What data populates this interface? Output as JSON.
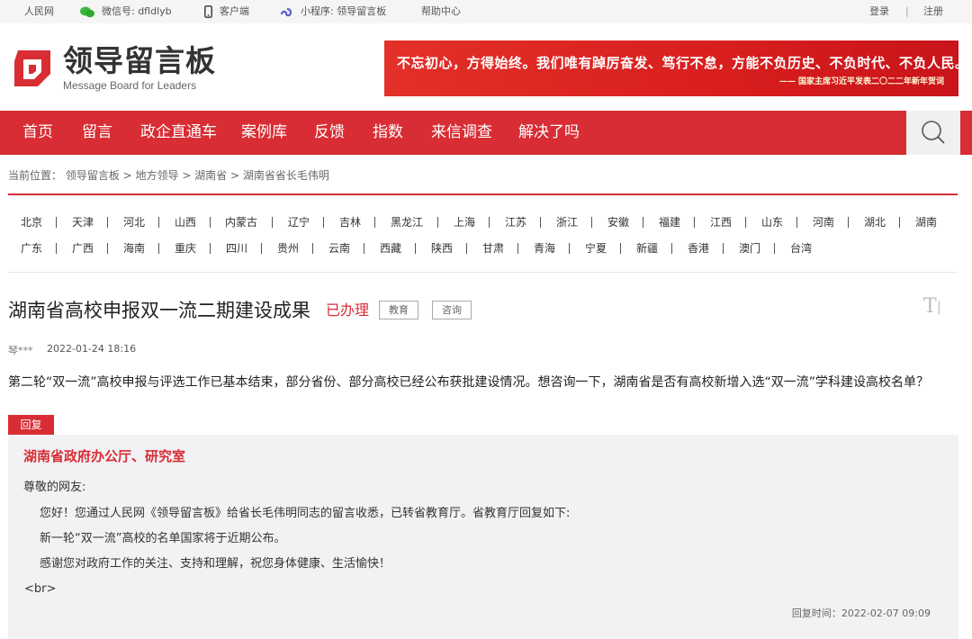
{
  "topbar": {
    "site": "人民网",
    "wechat": "微信号: dfldlyb",
    "client": "客户端",
    "miniprogram": "小程序: 领导留言板",
    "help": "帮助中心",
    "login": "登录",
    "divider": "|",
    "register": "注册"
  },
  "header": {
    "logo_cn": "领导留言板",
    "logo_en": "Message Board for Leaders",
    "banner_main": "不忘初心，方得始终。我们唯有踔厉奋发、笃行不怠，方能不负历史、不负时代、不负人民。",
    "banner_sub": "—— 国家主席习近平发表二〇二二年新年贺词"
  },
  "nav": {
    "items": [
      "首页",
      "留言",
      "政企直通车",
      "案例库",
      "反馈",
      "指数",
      "来信调查",
      "解决了吗"
    ]
  },
  "breadcrumb": "当前位置： 领导留言板 > 地方领导 > 湖南省 > 湖南省省长毛伟明",
  "regions": {
    "row1": [
      "北京",
      "天津",
      "河北",
      "山西",
      "内蒙古",
      "辽宁",
      "吉林",
      "黑龙江",
      "上海",
      "江苏",
      "浙江",
      "安徽",
      "福建",
      "江西",
      "山东",
      "河南",
      "湖北",
      "湖南"
    ],
    "row2": [
      "广东",
      "广西",
      "海南",
      "重庆",
      "四川",
      "贵州",
      "云南",
      "西藏",
      "陕西",
      "甘肃",
      "青海",
      "宁夏",
      "新疆",
      "香港",
      "澳门",
      "台湾"
    ]
  },
  "message": {
    "title": "湖南省高校申报双一流二期建设成果",
    "status": "已办理",
    "tags": [
      "教育",
      "咨询"
    ],
    "font_toggle": "T",
    "author": "琴***",
    "time": "2022-01-24 18:16",
    "content": "第二轮“双一流”高校申报与评选工作已基本结束，部分省份、部分高校已经公布获批建设情况。想咨询一下，湖南省是否有高校新增入选“双一流”学科建设高校名单？"
  },
  "reply": {
    "tab": "回复",
    "org": "湖南省政府办公厅、研究室",
    "greeting": "尊敬的网友:",
    "lines": [
      "您好！您通过人民网《领导留言板》给省长毛伟明同志的留言收悉，已转省教育厅。省教育厅回复如下:",
      "新一轮“双一流”高校的名单国家将于近期公布。",
      "感谢您对政府工作的关注、支持和理解，祝您身体健康、生活愉快！"
    ],
    "raw_tag": "<br>",
    "reply_time": "回复时间：2022-02-07 09:09"
  },
  "colors": {
    "brand_red": "#d82d34",
    "reply_bg": "#f2f2f5"
  }
}
